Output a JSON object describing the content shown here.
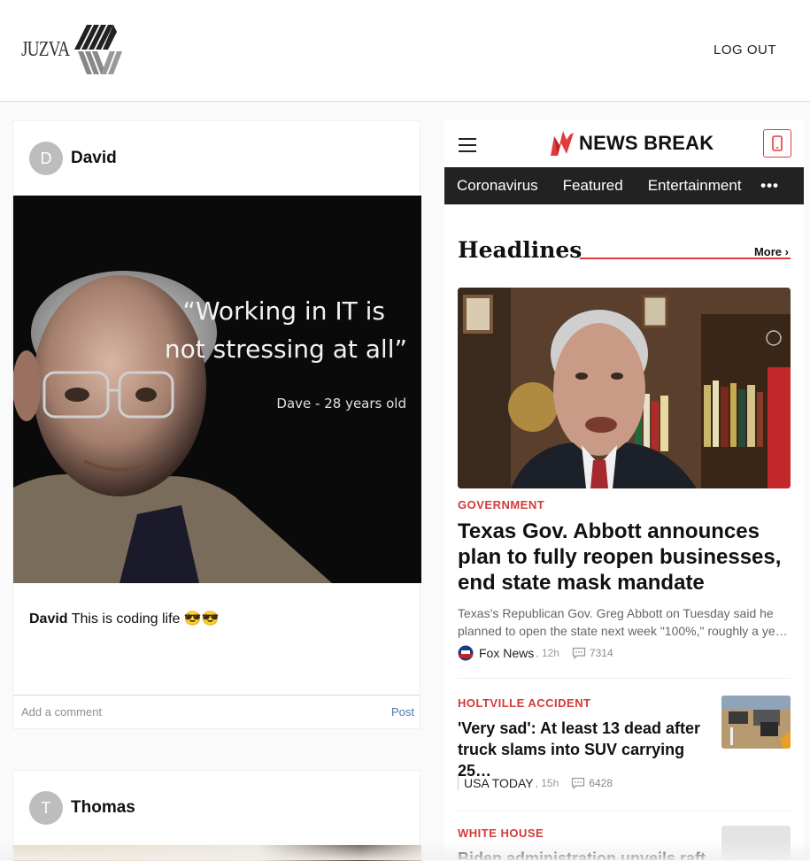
{
  "app": {
    "logo_text": "JUZVA",
    "logout_label": "LOG OUT"
  },
  "feed": {
    "posts": [
      {
        "avatar_initial": "D",
        "username": "David",
        "image": {
          "quote_line1": "“Working in IT is",
          "quote_line2": "not stressing at all”",
          "attribution": "Dave - 28 years old"
        },
        "caption_user": "David",
        "caption_text": " This is coding life 😎😎",
        "comment_placeholder": "Add a comment",
        "post_label": "Post"
      },
      {
        "avatar_initial": "T",
        "username": "Thomas"
      }
    ]
  },
  "newsbreak": {
    "brand": "NEWS BREAK",
    "nav": [
      "Coronavirus",
      "Featured",
      "Entertainment"
    ],
    "nav_more": "•••",
    "section_title": "Headlines",
    "more_label": "More",
    "accent": "#e23b3b",
    "articles": [
      {
        "category": "GOVERNMENT",
        "title": "Texas Gov. Abbott announces plan to fully reopen businesses, end state mask mandate",
        "desc_line1": "Texas’s Republican Gov. Greg Abbott on Tuesday said he",
        "desc_line2": "planned to open the state next week \"100%,\" roughly a ye…",
        "source": "Fox News",
        "time": ", 12h",
        "comments": "7314"
      },
      {
        "category": "HOLTVILLE ACCIDENT",
        "title_line1": "'Very sad': At least 13 dead after",
        "title_line2": "truck slams into SUV carrying 25…",
        "source": "USA TODAY",
        "time": ", 15h",
        "comments": "6428"
      },
      {
        "category": "WHITE HOUSE",
        "title_line1": "Biden administration unveils raft of"
      }
    ]
  }
}
